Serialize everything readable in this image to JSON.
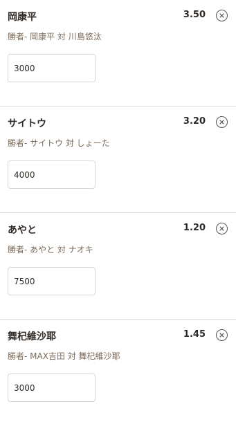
{
  "bets": [
    {
      "selection": "岡康平",
      "odds": "3.50",
      "market": "勝者- 岡康平 対 川島悠汰",
      "stake": "3000"
    },
    {
      "selection": "サイトウ",
      "odds": "3.20",
      "market": "勝者- サイトウ 対 しょーた",
      "stake": "4000"
    },
    {
      "selection": "あやと",
      "odds": "1.20",
      "market": "勝者- あやと 対 ナオキ",
      "stake": "7500"
    },
    {
      "selection": "舞杞維沙耶",
      "odds": "1.45",
      "market": "勝者- MAX吉田 対 舞杞維沙耶",
      "stake": "3000"
    }
  ],
  "icons": {
    "remove": "close-circle-icon"
  },
  "colors": {
    "text": "#2f2a26",
    "muted": "#7a6a5a",
    "divider": "#dcdcdc",
    "input_border": "#d6d6d6"
  }
}
